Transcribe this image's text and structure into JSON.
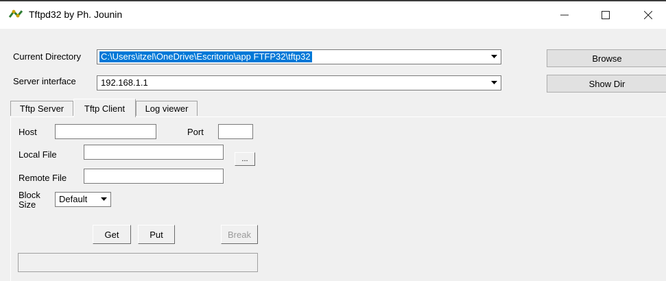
{
  "window": {
    "title": "Tftpd32 by Ph. Jounin",
    "icon": "tftpd32-app-icon",
    "controls": {
      "minimize": "—",
      "maximize": "☐",
      "close": "✕"
    }
  },
  "current_directory": {
    "label": "Current Directory",
    "value": "C:\\Users\\itzel\\OneDrive\\Escritorio\\app FTFP32\\tftp32"
  },
  "server_interface": {
    "label": "Server interface",
    "value": "192.168.1.1"
  },
  "buttons": {
    "browse": "Browse",
    "show_dir": "Show Dir"
  },
  "tabs": [
    {
      "label": "Tftp Server",
      "active": false
    },
    {
      "label": "Tftp Client",
      "active": true
    },
    {
      "label": "Log viewer",
      "active": false
    }
  ],
  "client": {
    "host_label": "Host",
    "host_value": "",
    "port_label": "Port",
    "port_value": "",
    "local_file_label": "Local File",
    "local_file_value": "",
    "browse_dots": "...",
    "remote_file_label": "Remote File",
    "remote_file_value": "",
    "block_label_1": "Block",
    "block_label_2": "Size",
    "block_size_value": "Default",
    "get": "Get",
    "put": "Put",
    "break": "Break"
  },
  "colors": {
    "selection": "#0078d7",
    "window_bg": "#f0f0f0"
  }
}
